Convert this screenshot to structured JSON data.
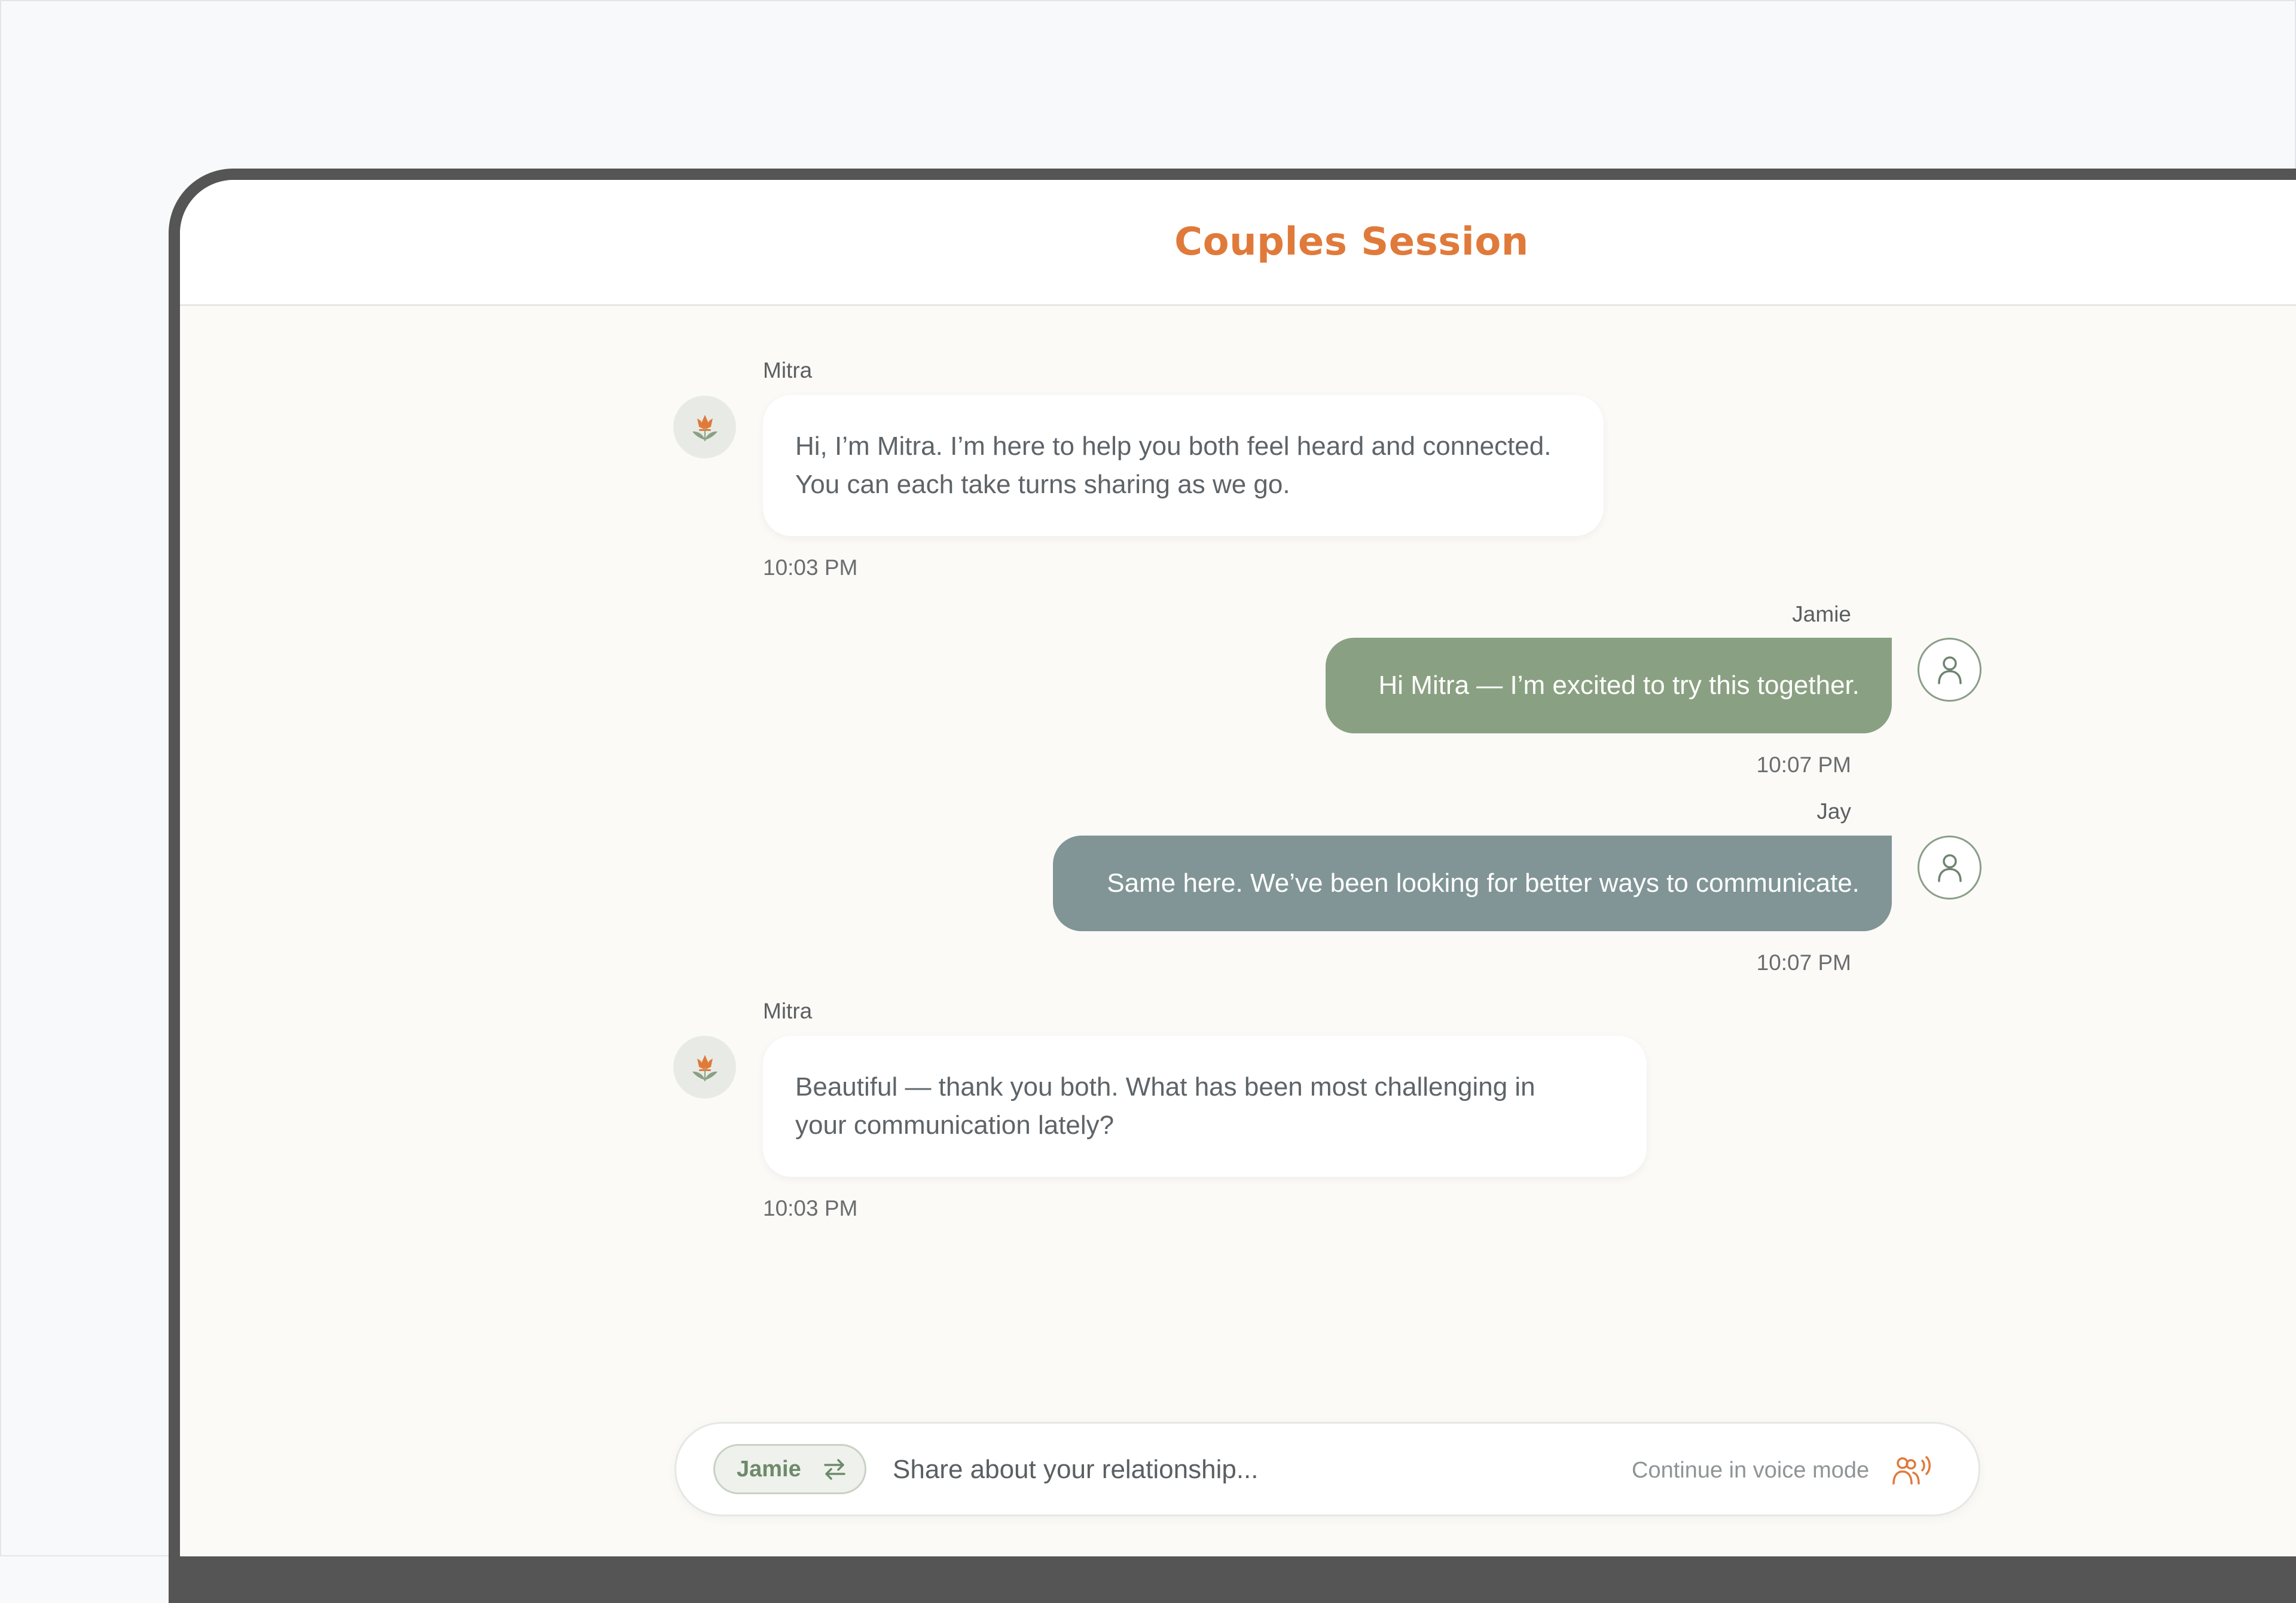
{
  "header": {
    "title": "Couples Session"
  },
  "messages": [
    {
      "sender": "Mitra",
      "text_lines": [
        "Hi, I’m Mitra. I’m here to help you both feel heard and connected.",
        "You can each take turns sharing as we go."
      ],
      "time": "10:03 PM",
      "role": "bot"
    },
    {
      "sender": "Jamie",
      "text": "Hi Mitra — I’m excited to try this together.",
      "time": "10:07 PM",
      "role": "user",
      "color": "#8aa082"
    },
    {
      "sender": "Jay",
      "text": "Same here. We’ve been looking for better ways to communicate.",
      "time": "10:07 PM",
      "role": "user",
      "color": "#819596"
    },
    {
      "sender": "Mitra",
      "text_lines": [
        "Beautiful — thank you both. What has been most challenging in",
        "your communication lately?"
      ],
      "time": "10:03 PM",
      "role": "bot"
    }
  ],
  "composer": {
    "speaker": "Jamie",
    "placeholder": "Share about your relationship...",
    "voice_label": "Continue in voice mode"
  },
  "icons": {
    "bot_avatar": "lotus-icon",
    "user_avatar": "person-icon",
    "speaker_switch": "swap-arrows-icon",
    "voice_mode": "voice-people-icon"
  },
  "colors": {
    "accent": "#e07a3b",
    "jamie_bubble": "#8aa082",
    "jay_bubble": "#819596",
    "background": "#fbfaf7"
  }
}
